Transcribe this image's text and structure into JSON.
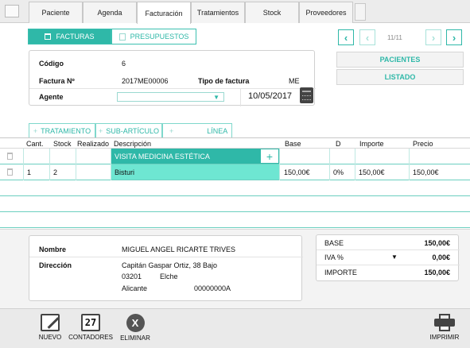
{
  "tabs": [
    {
      "label": "Paciente"
    },
    {
      "label": "Agenda"
    },
    {
      "label": "Facturación"
    },
    {
      "label": "Tratamientos"
    },
    {
      "label": "Stock"
    },
    {
      "label": "Proveedores"
    }
  ],
  "active_tab": "Facturación",
  "doc_toggle": {
    "facturas": "FACTURAS",
    "presupuestos": "PRESUPUESTOS"
  },
  "pager": {
    "text": "11/11"
  },
  "side_buttons": {
    "pacientes": "PACIENTES",
    "listado": "LISTADO"
  },
  "invoice": {
    "codigo_label": "Código",
    "codigo_value": "6",
    "factura_label": "Factura Nº",
    "factura_value": "2017ME00006",
    "tipo_label": "Tipo de factura",
    "tipo_value": "ME",
    "agente_label": "Agente",
    "agente_value": "",
    "fecha": "10/05/2017"
  },
  "line_tabs": {
    "tratamiento": "TRATAMIENTO",
    "subarticulo": "SUB-ARTÍCULO",
    "linea": "LÍNEA"
  },
  "columns": {
    "cant": "Cant.",
    "stock": "Stock",
    "realizado": "Realizado",
    "descripcion": "Descripción",
    "base": "Base",
    "d": "D",
    "importe": "Importe",
    "precio": "Precio"
  },
  "group_row": {
    "descripcion": "VISITA MEDICINA ESTÉTICA",
    "plus": "+"
  },
  "rows": [
    {
      "cant": "1",
      "stock": "2",
      "realizado": "",
      "descripcion": "Bisturi",
      "base": "150,00€",
      "d": "0%",
      "importe": "150,00€",
      "precio": "150,00€"
    }
  ],
  "patient": {
    "nombre_label": "Nombre",
    "nombre_value": "MIGUEL ANGEL RICARTE TRIVES",
    "direccion_label": "Dirección",
    "direccion_line1": "Capitán Gaspar Ortiz, 38 Bajo",
    "cp": "03201",
    "ciudad": "Elche",
    "provincia": "Alicante",
    "telefono": "00000000A"
  },
  "totals": {
    "base_label": "BASE",
    "base_value": "150,00€",
    "iva_label": "IVA %",
    "iva_value": "0,00€",
    "importe_label": "IMPORTE",
    "importe_value": "150,00€"
  },
  "toolbar": {
    "nuevo": "NUEVO",
    "contadores": "CONTADORES",
    "contadores_icon_text": "27",
    "eliminar": "ELIMINAR",
    "imprimir": "IMPRIMIR"
  },
  "colors": {
    "accent": "#2fb8a8",
    "highlight": "#6ee6d2",
    "group": "#2fb8a8"
  }
}
